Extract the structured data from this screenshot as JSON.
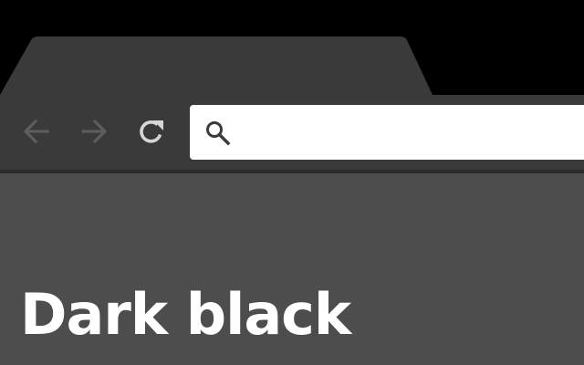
{
  "browser": {
    "omnibox": {
      "value": "",
      "placeholder": ""
    },
    "icons": {
      "back": "arrow-left-icon",
      "forward": "arrow-right-icon",
      "reload": "reload-icon",
      "search": "search-icon"
    }
  },
  "page": {
    "headline": "Dark black"
  },
  "colors": {
    "tab_strip": "#000000",
    "tab": "#3a3a3a",
    "toolbar": "#3a3a3a",
    "content": "#4d4d4d",
    "omnibox": "#ffffff",
    "nav_disabled": "#5e5e5e",
    "nav_enabled": "#d6d6d6",
    "headline": "#ffffff"
  }
}
